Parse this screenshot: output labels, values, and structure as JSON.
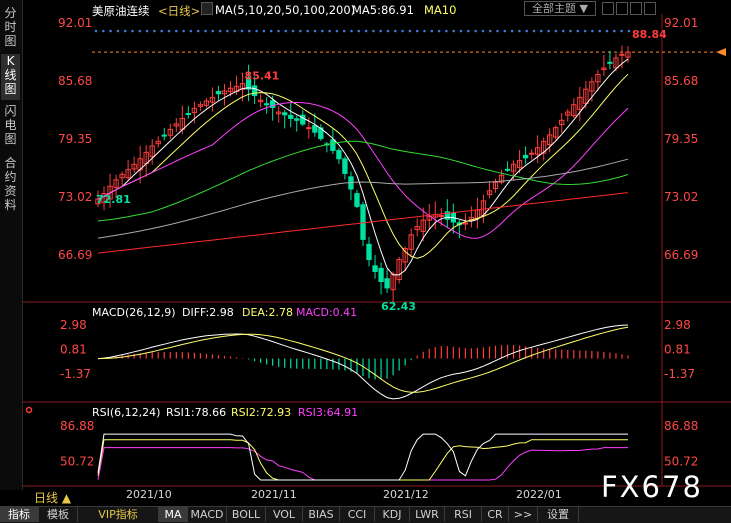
{
  "sidebar": {
    "items": [
      {
        "label": "分时图"
      },
      {
        "label": "K线图"
      },
      {
        "label": "闪电图"
      },
      {
        "label": "合约资料"
      }
    ]
  },
  "header": {
    "symbol": "美原油连续",
    "period": "<日线>",
    "ma_params": "MA(5,10,20,50,100,200)",
    "ma5": "MA5:86.91",
    "ma10": "MA10",
    "theme_select": "全部主题"
  },
  "colors": {
    "up": "#ff3c3c",
    "down": "#00e0a0",
    "ma5": "#ffffff",
    "ma10": "#ffff66",
    "ma20": "#ff40ff",
    "ma50": "#33dd33",
    "ma100": "#aaaaaa",
    "ma200": "#ff2a2a",
    "dif": "#ffffff",
    "dea": "#ffff66",
    "rsi1": "#ffffff",
    "rsi2": "#ffff66",
    "rsi3": "#ff40ff",
    "axis": "#ff4848",
    "dots": "#3a7bd5"
  },
  "price_axis": {
    "ticks": [
      "92.01",
      "85.68",
      "79.35",
      "73.02",
      "66.69"
    ],
    "current": "88.84"
  },
  "annotations": {
    "high": "85.41",
    "low": "62.43",
    "left": "72.81",
    "last_high": "88.84"
  },
  "macd": {
    "label": "MACD(26,12,9)",
    "diff": "DIFF:2.98",
    "dea": "DEA:2.78",
    "macd": "MACD:0.41",
    "ticks": [
      "2.98",
      "0.81",
      "-1.37"
    ]
  },
  "rsi": {
    "label": "RSI(6,12,24)",
    "rsi1": "RSI1:78.66",
    "rsi2": "RSI2:72.93",
    "rsi3": "RSI3:64.91",
    "ticks": [
      "86.88",
      "50.72"
    ]
  },
  "date_axis": {
    "labels": [
      "2021/10",
      "2021/11",
      "2021/12",
      "2022/01"
    ]
  },
  "period_label": "日线",
  "toolbar": {
    "tabs": [
      "指标",
      "模板",
      "VIP指标",
      "MA",
      "MACD",
      "BOLL",
      "VOL",
      "BIAS",
      "CCI",
      "KDJ",
      "LWR",
      "RSI",
      "CR",
      ">>",
      "设置"
    ]
  },
  "watermark": "FX678",
  "chart_data": {
    "type": "candlestick",
    "x_start": "2021-09-17",
    "x_end": "2022-01-20",
    "y_range": [
      62.0,
      93.0
    ],
    "price_closes": [
      72.8,
      73.4,
      74.2,
      74.9,
      75.5,
      76.0,
      76.6,
      77.2,
      77.9,
      78.6,
      79.1,
      79.7,
      80.4,
      81.0,
      81.6,
      82.1,
      82.7,
      83.1,
      83.5,
      83.9,
      84.3,
      84.6,
      84.9,
      85.1,
      85.4,
      84.8,
      84.1,
      83.6,
      83.2,
      82.8,
      82.3,
      82.0,
      81.6,
      81.4,
      81.0,
      80.6,
      80.1,
      79.4,
      78.8,
      78.1,
      77.2,
      75.6,
      73.9,
      72.0,
      68.4,
      66.2,
      64.9,
      63.8,
      63.1,
      64.6,
      66.2,
      67.4,
      68.9,
      69.8,
      70.5,
      70.9,
      71.1,
      71.0,
      70.6,
      70.3,
      70.0,
      70.2,
      70.8,
      71.6,
      72.6,
      73.7,
      74.6,
      75.4,
      76.0,
      76.6,
      77.0,
      77.3,
      77.8,
      78.4,
      79.1,
      79.8,
      80.6,
      81.4,
      82.3,
      83.1,
      83.9,
      84.8,
      85.6,
      86.4,
      87.1,
      87.7,
      88.2,
      88.6,
      88.84
    ],
    "macd": {
      "diff_last": 2.98,
      "dea_last": 2.78,
      "macd_last": 0.41,
      "range": [
        -3.5,
        3.6
      ]
    },
    "rsi": {
      "rsi1_last": 78.66,
      "rsi2_last": 72.93,
      "rsi3_last": 64.91,
      "range": [
        30,
        95
      ]
    }
  }
}
